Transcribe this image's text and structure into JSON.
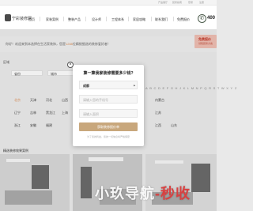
{
  "topbar": {
    "links": [
      "产品展厅",
      "装修指南",
      "登录",
      "注册"
    ]
  },
  "logo": {
    "text": "宁彩装修网"
  },
  "nav": {
    "items": [
      "首页",
      "家装案例",
      "整装产品",
      "设计师",
      "工程体系",
      "家居攻略",
      "联系我们",
      "免费报价"
    ]
  },
  "hotline": {
    "icon": "phone-icon",
    "icon_glyph": "✆",
    "number": "400"
  },
  "notice": {
    "prefix": "你好！欢迎来到本选择在生活家装饰，您是",
    "highlight": "1288",
    "suffix": "位精挑细选的装修爱好者！"
  },
  "free_button": {
    "line1": "免费报价",
    "line2": "领取装修方案"
  },
  "filters": {
    "area_label": "区域",
    "area_value": "省份",
    "city_value": "城市",
    "alphabet": "ABCDEFGHJKLMNPQRSTWXYZ",
    "cities_row1": [
      "北京",
      "天津",
      "河北",
      "山西",
      "内蒙古"
    ],
    "cities_row2": [
      "辽宁",
      "吉林",
      "黑龙江",
      "上海",
      "江苏"
    ],
    "cities_row3": [
      "浙江",
      "安徽",
      "福建",
      "江西",
      "山东"
    ]
  },
  "section": {
    "title": "精选装修效果案例"
  },
  "modal": {
    "title": "算一算我家装修需要多少钱?",
    "city_value": "成都",
    "area_placeholder": "请输入您的手机号",
    "name_placeholder": "请输入面积",
    "submit_label": "获取装修报价单",
    "note": "为了您的利益，您的一切信息将严格保密",
    "close_glyph": "×"
  },
  "watermark": {
    "text_main": "小玖导航",
    "text_accent": "-秒收"
  },
  "colors": {
    "accent": "#d98f5a",
    "submit": "#c8a77c",
    "brand_dark": "#4a5a4a"
  }
}
